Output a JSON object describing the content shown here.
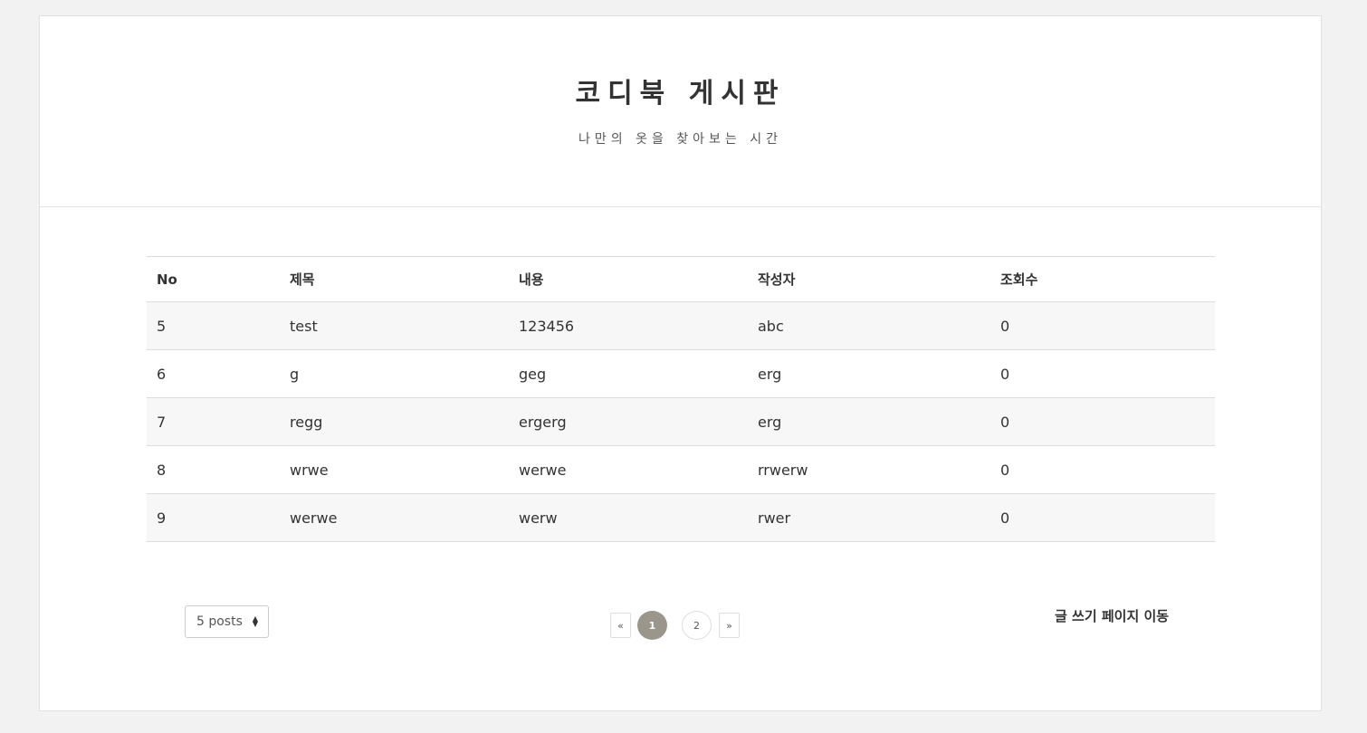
{
  "header": {
    "title": "코디북 게시판",
    "subtitle": "나만의 옷을 찾아보는 시간"
  },
  "table": {
    "columns": [
      "No",
      "제목",
      "내용",
      "작성자",
      "조회수"
    ],
    "rows": [
      [
        "5",
        "test",
        "123456",
        "abc",
        "0"
      ],
      [
        "6",
        "g",
        "geg",
        "erg",
        "0"
      ],
      [
        "7",
        "regg",
        "ergerg",
        "erg",
        "0"
      ],
      [
        "8",
        "wrwe",
        "werwe",
        "rrwerw",
        "0"
      ],
      [
        "9",
        "werwe",
        "werw",
        "rwer",
        "0"
      ]
    ]
  },
  "page_size_select": {
    "value": "5 posts"
  },
  "pagination": {
    "prev": "«",
    "pages": [
      "1",
      "2"
    ],
    "current": "1",
    "next": "»"
  },
  "write_link": "글 쓰기 페이지 이동",
  "colors": {
    "background": "#f2f2f2",
    "card": "#ffffff",
    "active_page": "#9b968b",
    "stripe": "#f7f7f7"
  }
}
